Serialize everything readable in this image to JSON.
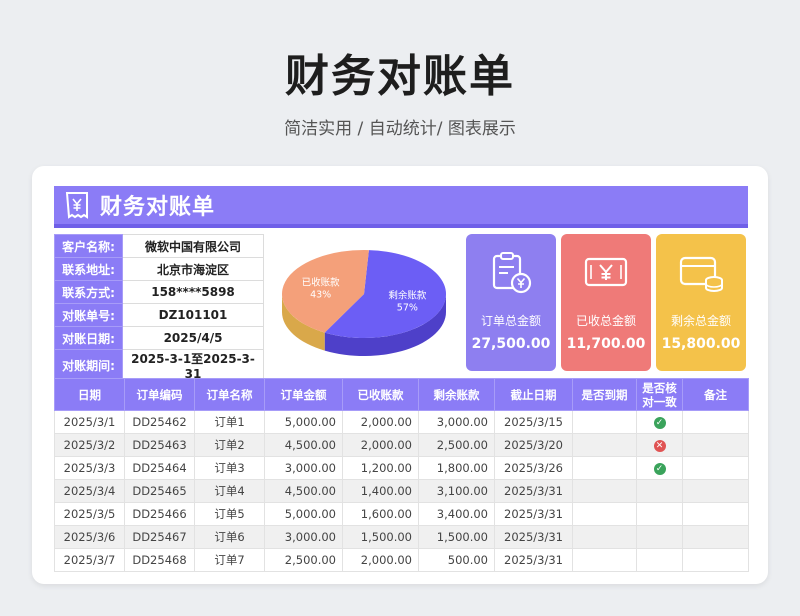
{
  "page": {
    "title": "财务对账单",
    "subtitle": "简洁实用 / 自动统计/ 图表展示"
  },
  "banner": {
    "title": "财务对账单"
  },
  "info": [
    {
      "label": "客户名称:",
      "value": "微软中国有限公司"
    },
    {
      "label": "联系地址:",
      "value": "北京市海淀区"
    },
    {
      "label": "联系方式:",
      "value": "158****5898"
    },
    {
      "label": "对账单号:",
      "value": "DZ101101"
    },
    {
      "label": "对账日期:",
      "value": "2025/4/5"
    },
    {
      "label": "对账期间:",
      "value": "2025-3-1至2025-3-31"
    }
  ],
  "chart_data": {
    "type": "pie",
    "categories": [
      "剩余账款",
      "已收账款"
    ],
    "values": [
      57,
      43
    ],
    "labels": [
      {
        "name": "剩余账款",
        "pct": "57%"
      },
      {
        "name": "已收账款",
        "pct": "43%"
      }
    ],
    "colors": [
      "#6c5ef5",
      "#f4a07a"
    ]
  },
  "kpis": [
    {
      "label": "订单总金额",
      "value": "27,500.00",
      "color": "#8e7ff0",
      "icon": "clipboard-yen-icon"
    },
    {
      "label": "已收总金额",
      "value": "11,700.00",
      "color": "#ef7a78",
      "icon": "banknote-yen-icon"
    },
    {
      "label": "剩余总金额",
      "value": "15,800.00",
      "color": "#f4c24a",
      "icon": "wallet-coins-icon"
    }
  ],
  "table": {
    "headers": [
      "日期",
      "订单编码",
      "订单名称",
      "订单金额",
      "已收账款",
      "剩余账款",
      "截止日期",
      "是否到期",
      "是否核对一致",
      "备注"
    ],
    "rows": [
      {
        "date": "2025/3/1",
        "code": "DD25462",
        "name": "订单1",
        "amount": "5,000.00",
        "received": "2,000.00",
        "remaining": "3,000.00",
        "due": "2025/3/15",
        "expired": "",
        "check": "ok",
        "note": ""
      },
      {
        "date": "2025/3/2",
        "code": "DD25463",
        "name": "订单2",
        "amount": "4,500.00",
        "received": "2,000.00",
        "remaining": "2,500.00",
        "due": "2025/3/20",
        "expired": "",
        "check": "bad",
        "note": ""
      },
      {
        "date": "2025/3/3",
        "code": "DD25464",
        "name": "订单3",
        "amount": "3,000.00",
        "received": "1,200.00",
        "remaining": "1,800.00",
        "due": "2025/3/26",
        "expired": "",
        "check": "ok",
        "note": ""
      },
      {
        "date": "2025/3/4",
        "code": "DD25465",
        "name": "订单4",
        "amount": "4,500.00",
        "received": "1,400.00",
        "remaining": "3,100.00",
        "due": "2025/3/31",
        "expired": "",
        "check": "",
        "note": ""
      },
      {
        "date": "2025/3/5",
        "code": "DD25466",
        "name": "订单5",
        "amount": "5,000.00",
        "received": "1,600.00",
        "remaining": "3,400.00",
        "due": "2025/3/31",
        "expired": "",
        "check": "",
        "note": ""
      },
      {
        "date": "2025/3/6",
        "code": "DD25467",
        "name": "订单6",
        "amount": "3,000.00",
        "received": "1,500.00",
        "remaining": "1,500.00",
        "due": "2025/3/31",
        "expired": "",
        "check": "",
        "note": ""
      },
      {
        "date": "2025/3/7",
        "code": "DD25468",
        "name": "订单7",
        "amount": "2,500.00",
        "received": "2,000.00",
        "remaining": "500.00",
        "due": "2025/3/31",
        "expired": "",
        "check": "",
        "note": ""
      }
    ]
  }
}
